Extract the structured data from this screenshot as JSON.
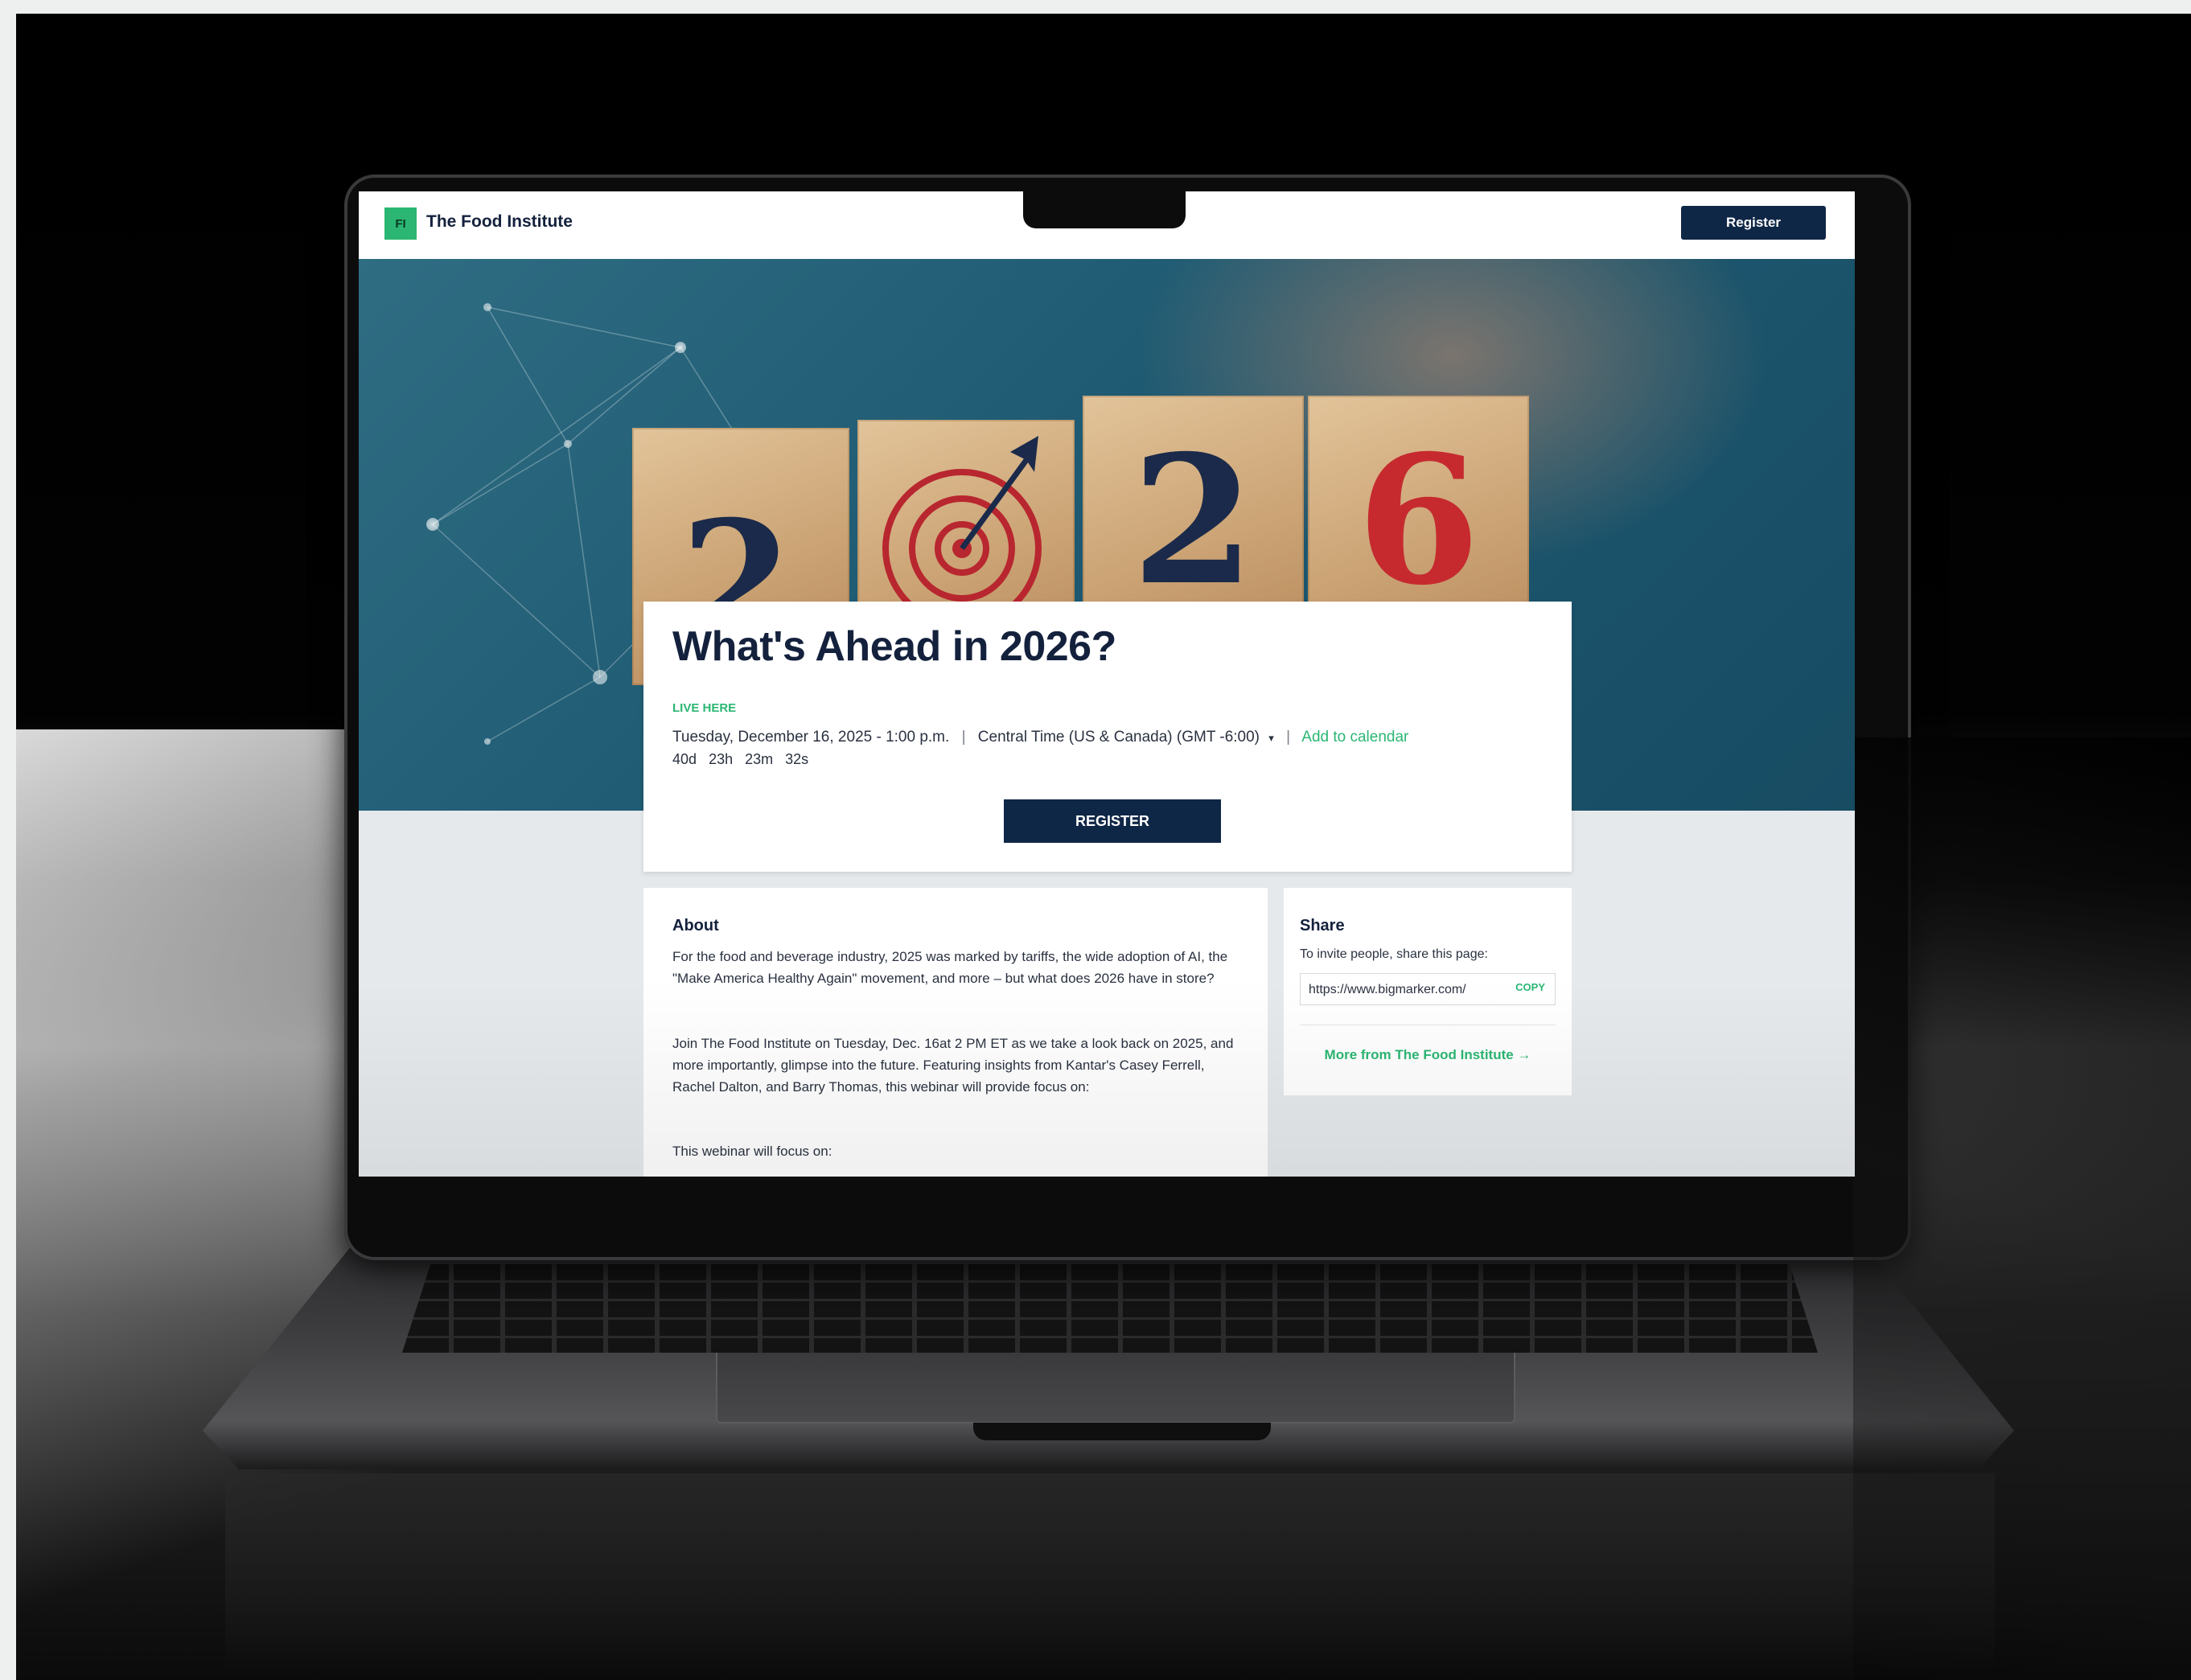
{
  "brand": {
    "logo_text": "FI",
    "name": "The Food Institute"
  },
  "nav": {
    "register_label": "Register"
  },
  "hero": {
    "digits": [
      "2",
      "2",
      "6"
    ]
  },
  "event": {
    "title": "What's Ahead in 2026?",
    "status": "LIVE HERE",
    "date": "Tuesday, December 16, 2025 - 1:00 p.m.",
    "timezone": "Central Time (US & Canada) (GMT -6:00)",
    "timezone_caret": "▾",
    "separator": "|",
    "add_to_calendar": "Add to calendar",
    "countdown": {
      "days": "40d",
      "hours": "23h",
      "minutes": "23m",
      "seconds": "32s"
    },
    "register_label": "REGISTER"
  },
  "about": {
    "title": "About",
    "paragraphs": [
      "For the food and beverage industry, 2025 was marked by tariffs, the wide adoption of AI, the \"Make America Healthy Again\" movement, and more – but what does 2026 have in store?",
      "Join The Food Institute on Tuesday, Dec. 16at 2 PM ET as we take a look back on 2025, and more importantly, glimpse into the future. Featuring insights from Kantar's Casey Ferrell, Rachel Dalton, and Barry Thomas, this webinar will provide focus on:",
      "This webinar will focus on:"
    ]
  },
  "share": {
    "title": "Share",
    "invite_text": "To invite people, share this page:",
    "url": "https://www.bigmarker.com/",
    "copy_label": "COPY",
    "more_link": "More from The Food Institute →"
  },
  "colors": {
    "navy": "#0f2747",
    "green": "#2bb673",
    "hero_teal": "#1e5a72",
    "page_bg": "#e6e9ec"
  }
}
